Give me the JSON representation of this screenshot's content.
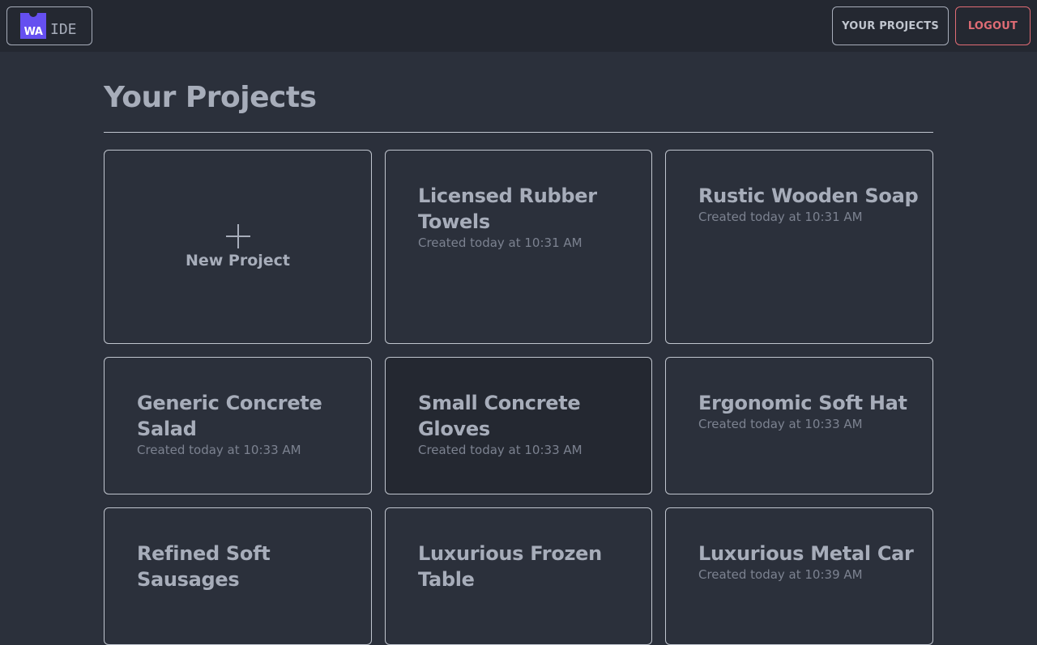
{
  "header": {
    "logo_mark": "WA",
    "logo_text": "IDE",
    "nav_projects": "YOUR PROJECTS",
    "nav_logout": "LOGOUT"
  },
  "page": {
    "title": "Your Projects"
  },
  "new_project": {
    "label": "New Project"
  },
  "projects": [
    {
      "name": "Licensed Rubber Towels",
      "created": "Created today at 10:31 AM"
    },
    {
      "name": "Rustic Wooden Soap",
      "created": "Created today at 10:31 AM"
    },
    {
      "name": "Generic Concrete Salad",
      "created": "Created today at 10:33 AM"
    },
    {
      "name": "Small Concrete Gloves",
      "created": "Created today at 10:33 AM"
    },
    {
      "name": "Ergonomic Soft Hat",
      "created": "Created today at 10:33 AM"
    },
    {
      "name": "Refined Soft Sausages",
      "created": ""
    },
    {
      "name": "Luxurious Frozen Table",
      "created": ""
    },
    {
      "name": "Luxurious Metal Car",
      "created": "Created today at 10:39 AM"
    }
  ],
  "colors": {
    "background": "#2b303b",
    "header": "#242831",
    "brand": "#654ff0",
    "logout": "#e06c75"
  }
}
